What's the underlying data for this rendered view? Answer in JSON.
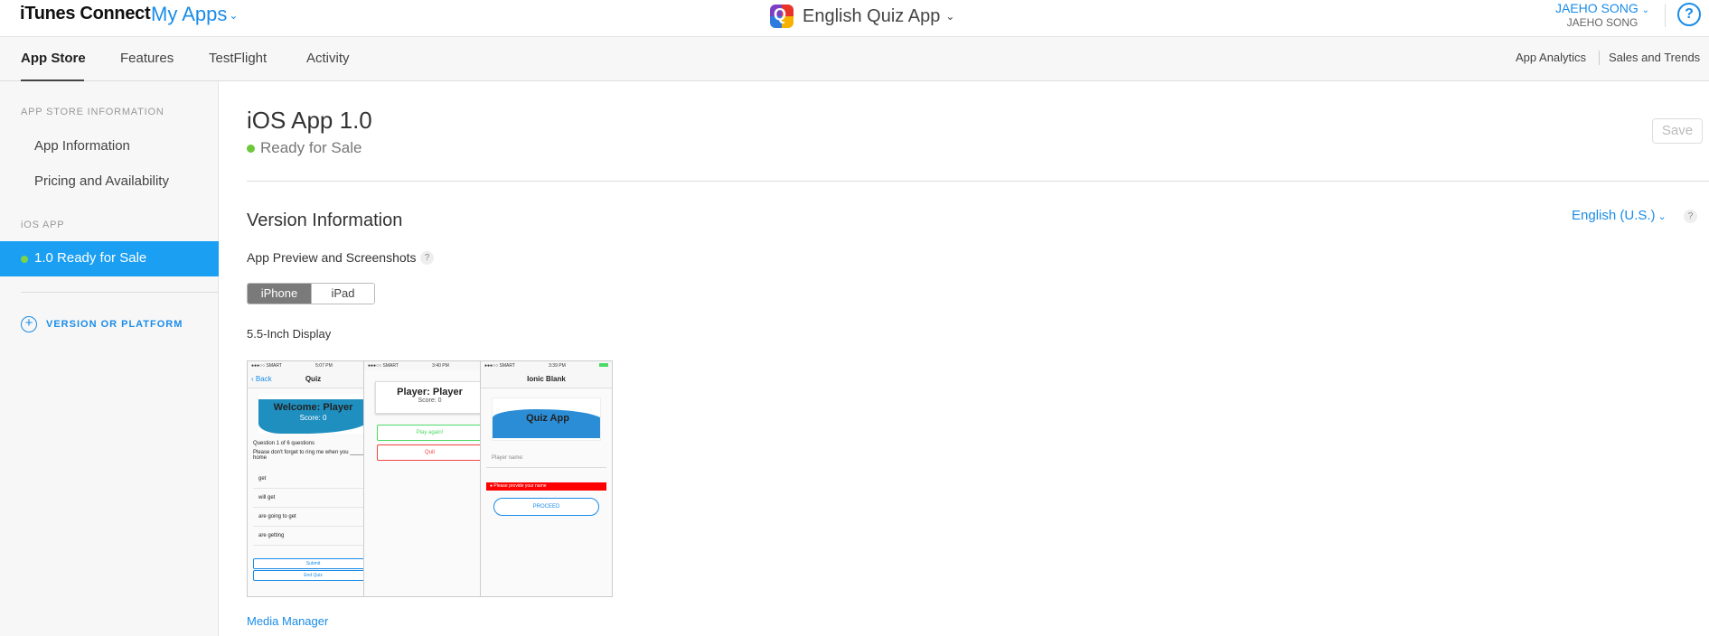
{
  "header": {
    "brand": "iTunes Connect",
    "my_apps": "My Apps",
    "app_name": "English Quiz App",
    "user_name": "JAEHO SONG",
    "user_sub": "JAEHO SONG",
    "help": "?"
  },
  "tabs": [
    {
      "label": "App Store",
      "active": true
    },
    {
      "label": "Features",
      "active": false
    },
    {
      "label": "TestFlight",
      "active": false
    },
    {
      "label": "Activity",
      "active": false
    }
  ],
  "right_links": [
    "App Analytics",
    "Sales and Trends"
  ],
  "sidebar": {
    "section1": "APP STORE INFORMATION",
    "items": [
      "App Information",
      "Pricing and Availability"
    ],
    "section2": "iOS APP",
    "active_item": "1.0 Ready for Sale",
    "add_version": "VERSION OR PLATFORM"
  },
  "main": {
    "title": "iOS App 1.0",
    "status": "Ready for Sale",
    "save": "Save",
    "section_title": "Version Information",
    "language": "English (U.S.)",
    "preview_title": "App Preview and Screenshots",
    "device_tabs": [
      "iPhone",
      "iPad"
    ],
    "display_title": "5.5-Inch Display",
    "media_manager": "Media Manager"
  },
  "screenshots": {
    "s1": {
      "carrier": "●●●○○ SMART",
      "time": "5:07 PM",
      "back": "Back",
      "nav_title": "Quiz",
      "welcome": "Welcome: Player",
      "score": "Score: 0",
      "question_num": "Question 1 of 6 questions",
      "question": "Please don't forget to ring me when you _____ home",
      "answers": [
        "get",
        "will get",
        "are going to get",
        "are getting"
      ],
      "submit": "Submit",
      "end": "End Quiz"
    },
    "s2": {
      "carrier": "●●●○○ SMART",
      "time": "3:40 PM",
      "player": "Player: Player",
      "score": "Score: 0",
      "play_again": "Play again!",
      "quit": "Quit"
    },
    "s3": {
      "carrier": "●●●○○ SMART",
      "time": "3:39 PM",
      "nav_title": "Ionic Blank",
      "logo": "Quiz App",
      "player_name": "Player name:",
      "error": "Please provide your name",
      "proceed": "PROCEED"
    }
  },
  "colors": {
    "accent": "#1a8ce8",
    "active_sidebar": "#1a9ff2",
    "status_green": "#6dc83a"
  }
}
